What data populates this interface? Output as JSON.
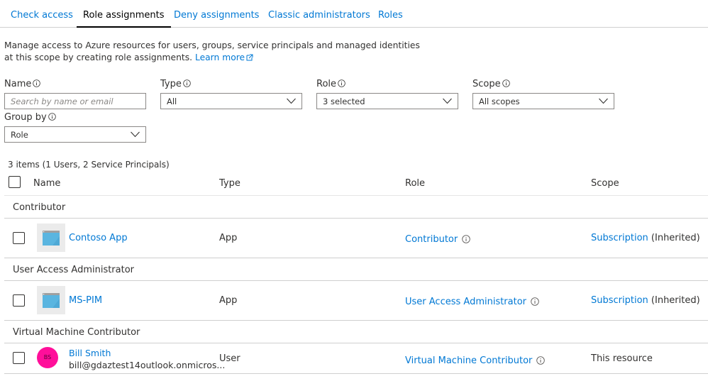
{
  "tabs": [
    {
      "label": "Check access",
      "active": false
    },
    {
      "label": "Role assignments",
      "active": true
    },
    {
      "label": "Deny assignments",
      "active": false
    },
    {
      "label": "Classic administrators",
      "active": false
    },
    {
      "label": "Roles",
      "active": false
    }
  ],
  "description": {
    "text": "Manage access to Azure resources for users, groups, service principals and managed identities at this scope by creating role assignments.",
    "learn_more": "Learn more"
  },
  "filters": {
    "name": {
      "label": "Name",
      "placeholder": "Search by name or email",
      "value": ""
    },
    "type": {
      "label": "Type",
      "value": "All"
    },
    "role": {
      "label": "Role",
      "value": "3 selected"
    },
    "scope": {
      "label": "Scope",
      "value": "All scopes"
    },
    "group_by": {
      "label": "Group by",
      "value": "Role"
    }
  },
  "summary": "3 items (1 Users, 2 Service Principals)",
  "table": {
    "columns": [
      "Name",
      "Type",
      "Role",
      "Scope"
    ],
    "groups": [
      {
        "name": "Contributor",
        "rows": [
          {
            "icon": "app-icon",
            "name": "Contoso App",
            "email": "",
            "type": "App",
            "role": "Contributor",
            "scope_link": "Subscription",
            "scope_suffix": "(Inherited)"
          }
        ]
      },
      {
        "name": "User Access Administrator",
        "rows": [
          {
            "icon": "app-icon",
            "name": "MS-PIM",
            "email": "",
            "type": "App",
            "role": "User Access Administrator",
            "scope_link": "Subscription",
            "scope_suffix": "(Inherited)"
          }
        ]
      },
      {
        "name": "Virtual Machine Contributor",
        "rows": [
          {
            "icon": "avatar",
            "initials": "BS",
            "avatar_color": "#ff0f9a",
            "name": "Bill Smith",
            "email": "bill@gdaztest14outlook.onmicros...",
            "type": "User",
            "role": "Virtual Machine Contributor",
            "scope_text": "This resource"
          }
        ]
      }
    ]
  },
  "colors": {
    "link": "#0078d4",
    "text": "#323130",
    "avatar": "#ff0f9a"
  }
}
